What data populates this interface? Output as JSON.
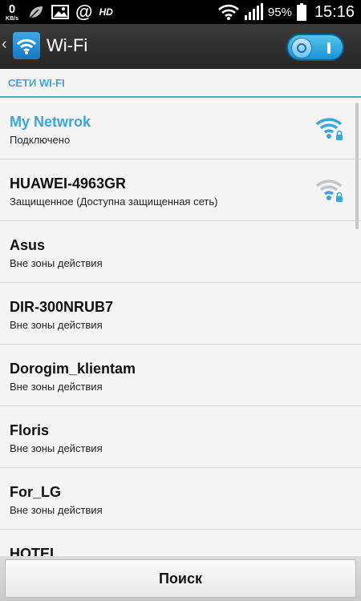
{
  "status_bar": {
    "speed_value": "0",
    "speed_unit": "KB/s",
    "hd_label": "HD",
    "at_symbol": "@",
    "battery": "95%",
    "time": "15:16"
  },
  "header": {
    "back_glyph": "‹",
    "title": "Wi-Fi",
    "toggle_on": true
  },
  "section": {
    "label": "СЕТИ WI-FI"
  },
  "networks": [
    {
      "name": "My Netwrok",
      "status": "Подключено",
      "active": true,
      "signal": "strong-locked"
    },
    {
      "name": "HUAWEI-4963GR",
      "status": "Защищенное  (Доступна защищенная сеть)",
      "active": false,
      "signal": "weak-locked"
    },
    {
      "name": "Asus",
      "status": "Вне зоны действия",
      "active": false,
      "signal": "none"
    },
    {
      "name": "DIR-300NRUB7",
      "status": "Вне зоны действия",
      "active": false,
      "signal": "none"
    },
    {
      "name": "Dorogim_klientam",
      "status": "Вне зоны действия",
      "active": false,
      "signal": "none"
    },
    {
      "name": "Floris",
      "status": "Вне зоны действия",
      "active": false,
      "signal": "none"
    },
    {
      "name": "For_LG",
      "status": "Вне зоны действия",
      "active": false,
      "signal": "none"
    },
    {
      "name": "HOTEL",
      "status": "",
      "active": false,
      "signal": "none"
    }
  ],
  "bottom": {
    "search_label": "Поиск"
  },
  "colors": {
    "accent": "#3ba6dc",
    "header_bg": "#2e2e2e",
    "list_bg": "#f5f5f5"
  }
}
